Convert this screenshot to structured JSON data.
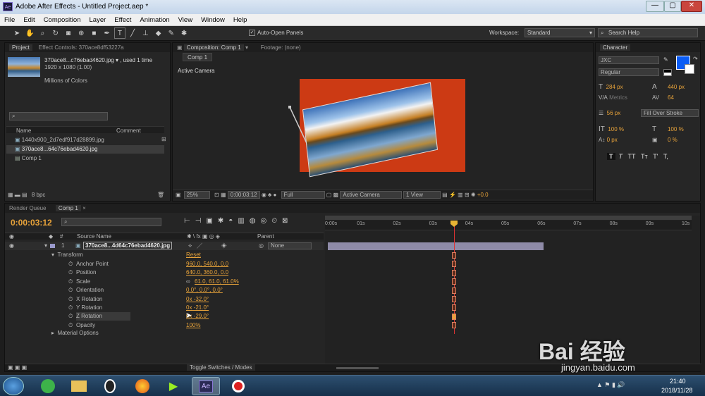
{
  "window": {
    "title": "Adobe After Effects - Untitled Project.aep *",
    "app_icon": "Ae",
    "controls": [
      "—",
      "▢",
      "✕"
    ]
  },
  "menu": [
    "File",
    "Edit",
    "Composition",
    "Layer",
    "Effect",
    "Animation",
    "View",
    "Window",
    "Help"
  ],
  "toolbar": {
    "auto_open_label": "Auto-Open Panels",
    "workspace_label": "Workspace:",
    "workspace_value": "Standard",
    "search_placeholder": "Search Help"
  },
  "project": {
    "tab_project": "Project",
    "tab_effect_controls": "Effect Controls: 370ace8df53227a",
    "selected_name": "370ace8...c76ebad4620.jpg ▾ , used 1 time",
    "selected_dims": "1920 x 1080 (1.00)",
    "selected_colors": "Millions of Colors",
    "col_name": "Name",
    "col_comment": "Comment",
    "items": [
      "1440x900_2d7edf917d28899.jpg",
      "370ace8...64c76ebad4620.jpg",
      "Comp 1"
    ],
    "bpc": "8 bpc"
  },
  "composition": {
    "tab_comp": "Composition: Comp 1",
    "tab_footage": "Footage: (none)",
    "subtab": "Comp 1",
    "active_camera": "Active Camera",
    "zoom": "25%",
    "timecode": "0:00:03:12",
    "resolution": "Full",
    "view": "Active Camera",
    "views_count": "1 View",
    "exposure": "+0.0"
  },
  "character": {
    "tab": "Character",
    "font": "JXC",
    "style": "Regular",
    "size": "284 px",
    "leading": "440 px",
    "kerning": "Metrics",
    "tracking": "64",
    "stroke_width": "56 px",
    "stroke_mode": "Fill Over Stroke",
    "vscale": "100 %",
    "hscale": "100 %",
    "baseline": "0 px",
    "tsume": "0 %",
    "fill_color": "#0a5cf5",
    "style_buttons": [
      "T",
      "T",
      "TT",
      "Tт",
      "T'",
      "T,"
    ]
  },
  "timeline": {
    "tab_render": "Render Queue",
    "tab_comp": "Comp 1",
    "timecode": "0:00:03:12",
    "col_source": "Source Name",
    "col_parent": "Parent",
    "layer_num": "1",
    "layer_name": "370ace8...4d64c76ebad4620.jpg",
    "parent_value": "None",
    "transform_label": "Transform",
    "reset_label": "Reset",
    "properties": [
      {
        "name": "Anchor Point",
        "value": "960.0, 540.0, 0.0"
      },
      {
        "name": "Position",
        "value": "640.0, 360.0, 0.0"
      },
      {
        "name": "Scale",
        "value": "61.0, 61.0, 61.0%"
      },
      {
        "name": "Orientation",
        "value": "0.0°, 0.0°, 0.0°"
      },
      {
        "name": "X Rotation",
        "value": "0x -32.0°"
      },
      {
        "name": "Y Rotation",
        "value": "0x -21.0°"
      },
      {
        "name": "Z Rotation",
        "value": "0x -29.0°"
      },
      {
        "name": "Opacity",
        "value": "100%"
      }
    ],
    "material_label": "Material Options",
    "ruler": [
      "0:00s",
      "01s",
      "02s",
      "03s",
      "04s",
      "05s",
      "06s",
      "07s",
      "08s",
      "09s",
      "10s"
    ],
    "toggle_label": "Toggle Switches / Modes"
  },
  "taskbar": {
    "time": "21:40",
    "date": "2018/11/28"
  },
  "watermark": {
    "brand": "Bai 经验",
    "url": "jingyan.baidu.com"
  }
}
